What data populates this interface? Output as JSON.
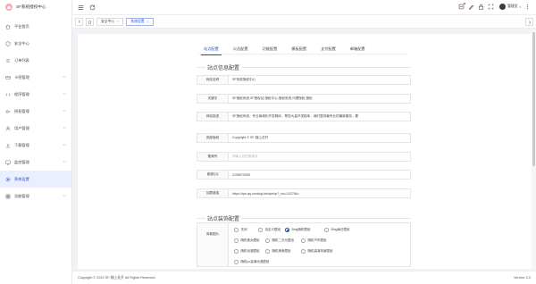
{
  "app": {
    "name": "SF系统授权中心"
  },
  "sidebar": {
    "items": [
      {
        "label": "平台首页",
        "icon": "home-icon",
        "has_children": false,
        "active": false
      },
      {
        "label": "安全中心",
        "icon": "shield-icon",
        "has_children": false,
        "active": false
      },
      {
        "label": "订单列表",
        "icon": "list-icon",
        "has_children": false,
        "active": false
      },
      {
        "label": "卡密管理",
        "icon": "card-icon",
        "has_children": true,
        "active": false
      },
      {
        "label": "程序管理",
        "icon": "code-icon",
        "has_children": true,
        "active": false
      },
      {
        "label": "授权管理",
        "icon": "key-icon",
        "has_children": true,
        "active": false
      },
      {
        "label": "用户管理",
        "icon": "user-icon",
        "has_children": true,
        "active": false
      },
      {
        "label": "下载管理",
        "icon": "download-icon",
        "has_children": true,
        "active": false
      },
      {
        "label": "监控管理",
        "icon": "monitor-icon",
        "has_children": true,
        "active": false
      },
      {
        "label": "系统设置",
        "icon": "gear-icon",
        "has_children": false,
        "active": true
      },
      {
        "label": "功能管理",
        "icon": "apps-icon",
        "has_children": true,
        "active": false
      }
    ]
  },
  "header": {
    "username": "管理员"
  },
  "tabbar": {
    "tabs": [
      {
        "label": "安全中心",
        "close": "×",
        "active": false
      },
      {
        "label": "系统设置",
        "close": "×",
        "active": true
      }
    ]
  },
  "content_tabs": [
    "站点配置",
    "公告配置",
    "功能配置",
    "模板配置",
    "支付配置",
    "邮箱配置"
  ],
  "site_section": {
    "title": "站点信息配置"
  },
  "site_fields": [
    {
      "label": "网站名称",
      "value": "SF系统授权中心",
      "placeholder": false
    },
    {
      "label": "关键字",
      "value": "SF授权系统,SF授权站,授权中心,授权系统,代理授权,授权",
      "placeholder": false
    },
    {
      "label": "网站描述",
      "value": "SF授权系统，专业商城化开发程序，帮您大量开发程序，我们提供最专业的最新服务，要",
      "placeholder": false
    },
    {
      "label": "底部版权",
      "value": "Copyright © SF-随上花开",
      "placeholder": false
    },
    {
      "label": "备案号",
      "value": "请输入您的备案号",
      "placeholder": true
    },
    {
      "label": "客服QQ",
      "value": "2105970390",
      "placeholder": false
    },
    {
      "label": "加群链接",
      "value": "https://qm.qq.com/cgi-bin/qm/qr?_wv=1027&k=",
      "placeholder": false
    }
  ],
  "decor_section": {
    "title": "站点装饰配置"
  },
  "background": {
    "label": "背景图片",
    "options": [
      {
        "label": "关闭",
        "selected": false
      },
      {
        "label": "自定义壁纸",
        "selected": false
      },
      {
        "label": "Bing随机壁纸",
        "selected": true
      },
      {
        "label": "Bing每日壁纸",
        "selected": false
      },
      {
        "label": "随机美女壁纸",
        "selected": false
      },
      {
        "label": "随机二次元壁纸",
        "selected": false
      },
      {
        "label": "随机汽车壁纸",
        "selected": false
      },
      {
        "label": "随机动漫壁纸",
        "selected": false
      },
      {
        "label": "随机美食壁纸",
        "selected": false
      },
      {
        "label": "随机高清风景壁纸",
        "selected": false
      },
      {
        "label": "随机pc高清动漫壁纸",
        "selected": false
      }
    ]
  },
  "footer": {
    "copyright": "Copyright © 2022 SF-随上花开 All Rights Reserved.",
    "version": "Version 3.0"
  },
  "colors": {
    "accent": "#1e50d4",
    "active_bg": "#e9efff",
    "logo": "#f6a9b6",
    "badge": "#e54545"
  }
}
